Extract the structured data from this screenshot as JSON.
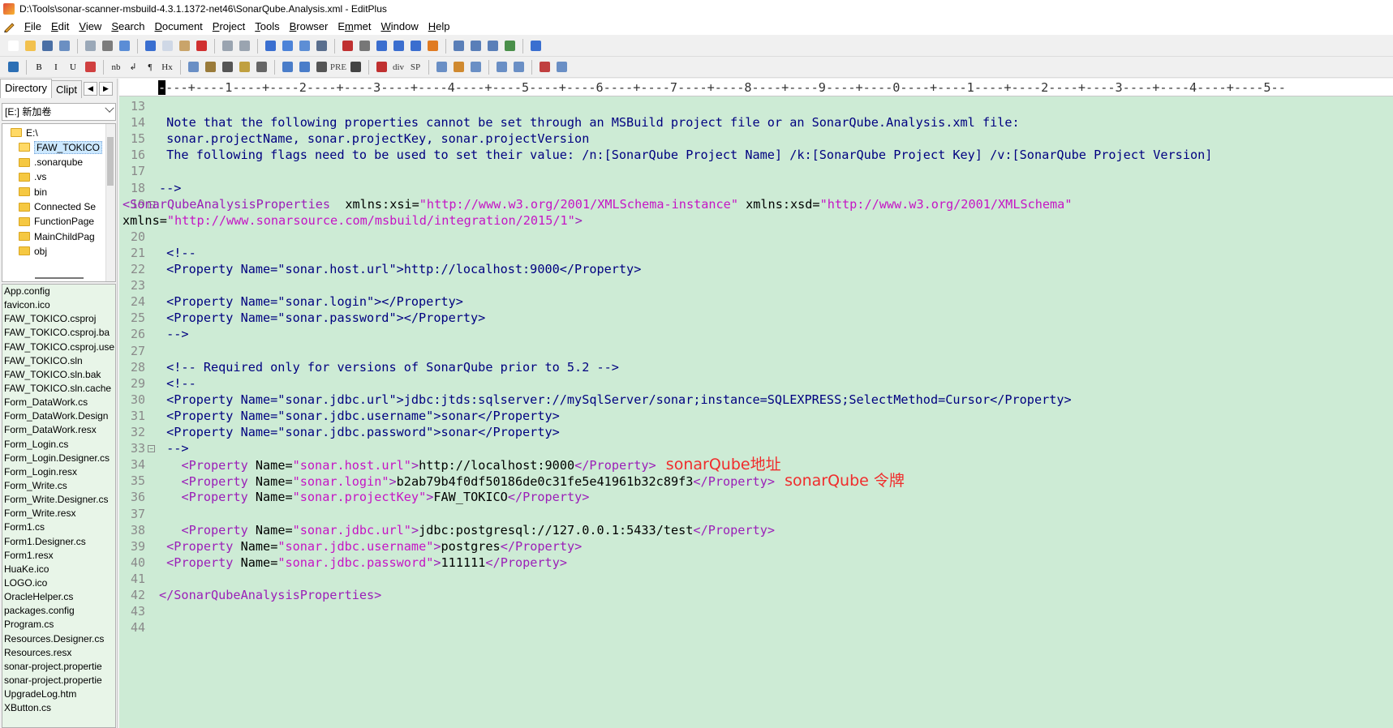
{
  "window": {
    "title": "D:\\Tools\\sonar-scanner-msbuild-4.3.1.1372-net46\\SonarQube.Analysis.xml - EditPlus"
  },
  "menu": [
    "File",
    "Edit",
    "View",
    "Search",
    "Document",
    "Project",
    "Tools",
    "Browser",
    "Emmet",
    "Window",
    "Help"
  ],
  "menu_hotkeys": [
    "F",
    "E",
    "V",
    "S",
    "D",
    "P",
    "T",
    "B",
    "m",
    "W",
    "H"
  ],
  "toolbar2_labels": {
    "bold": "B",
    "italic": "I",
    "underline": "U",
    "nbsp": "nb",
    "br": "↲",
    "para": "¶",
    "heading": "Hx",
    "pre": "PRE",
    "div": "div",
    "span": "SP"
  },
  "panel": {
    "tab_directory": "Directory",
    "tab_clipboard": "Clipt",
    "drive": "[E:] 新加卷",
    "tree": [
      "E:\\",
      "FAW_TOKICO",
      ".sonarqube",
      ".vs",
      "bin",
      "Connected Se",
      "FunctionPage",
      "MainChildPag",
      "obj"
    ],
    "files": [
      "App.config",
      "favicon.ico",
      "FAW_TOKICO.csproj",
      "FAW_TOKICO.csproj.ba",
      "FAW_TOKICO.csproj.use",
      "FAW_TOKICO.sln",
      "FAW_TOKICO.sln.bak",
      "FAW_TOKICO.sln.cache",
      "Form_DataWork.cs",
      "Form_DataWork.Design",
      "Form_DataWork.resx",
      "Form_Login.cs",
      "Form_Login.Designer.cs",
      "Form_Login.resx",
      "Form_Write.cs",
      "Form_Write.Designer.cs",
      "Form_Write.resx",
      "Form1.cs",
      "Form1.Designer.cs",
      "Form1.resx",
      "HuaKe.ico",
      "LOGO.ico",
      "OracleHelper.cs",
      "packages.config",
      "Program.cs",
      "Resources.Designer.cs",
      "Resources.resx",
      "sonar-project.propertie",
      "sonar-project.propertie",
      "UpgradeLog.htm",
      "XButton.cs"
    ]
  },
  "ruler": "---+----1----+----2----+----3----+----4----+----5----+----6----+----7----+----8----+----9----+----0----+----1----+----2----+----3----+----4----+----5--",
  "editor": {
    "lines": [
      {
        "n": "13",
        "t": ""
      },
      {
        "n": "14",
        "t": " Note that the following properties cannot be set through an MSBuild project file or an SonarQube.Analysis.xml file:"
      },
      {
        "n": "15",
        "t": " sonar.projectName, sonar.projectKey, sonar.projectVersion"
      },
      {
        "n": "16",
        "t": " The following flags need to be used to set their value: /n:[SonarQube Project Name] /k:[SonarQube Project Key] /v:[SonarQube Project Version]"
      },
      {
        "n": "17",
        "t": ""
      },
      {
        "n": "18",
        "t": "-->"
      },
      {
        "n": "19",
        "t": ""
      },
      {
        "n": "",
        "t": ""
      },
      {
        "n": "20",
        "t": ""
      },
      {
        "n": "21",
        "t": " <!--"
      },
      {
        "n": "22",
        "t": " <Property Name=\"sonar.host.url\">http://localhost:9000</Property>"
      },
      {
        "n": "23",
        "t": ""
      },
      {
        "n": "24",
        "t": " <Property Name=\"sonar.login\"></Property>"
      },
      {
        "n": "25",
        "t": " <Property Name=\"sonar.password\"></Property>"
      },
      {
        "n": "26",
        "t": " -->"
      },
      {
        "n": "27",
        "t": ""
      },
      {
        "n": "28",
        "t": " <!-- Required only for versions of SonarQube prior to 5.2 -->"
      },
      {
        "n": "29",
        "t": " <!--"
      },
      {
        "n": "30",
        "t": " <Property Name=\"sonar.jdbc.url\">jdbc:jtds:sqlserver://mySqlServer/sonar;instance=SQLEXPRESS;SelectMethod=Cursor</Property>"
      },
      {
        "n": "31",
        "t": " <Property Name=\"sonar.jdbc.username\">sonar</Property>"
      },
      {
        "n": "32",
        "t": " <Property Name=\"sonar.jdbc.password\">sonar</Property>"
      },
      {
        "n": "33",
        "t": " -->"
      },
      {
        "n": "34",
        "t": ""
      },
      {
        "n": "35",
        "t": ""
      },
      {
        "n": "36",
        "t": ""
      },
      {
        "n": "37",
        "t": ""
      },
      {
        "n": "38",
        "t": ""
      },
      {
        "n": "39",
        "t": ""
      },
      {
        "n": "40",
        "t": ""
      },
      {
        "n": "41",
        "t": ""
      },
      {
        "n": "42",
        "t": ""
      },
      {
        "n": "43",
        "t": ""
      },
      {
        "n": "44",
        "t": ""
      }
    ],
    "line19": {
      "tag": "SonarQubeAnalysisProperties",
      "a1": "xmlns:xsi",
      "v1": "\"http://www.w3.org/2001/XMLSchema-instance\"",
      "a2": "xmlns:xsd",
      "v2": "\"http://www.w3.org/2001/XMLSchema\"",
      "a3": "xmlns",
      "v3": "\"http://www.sonarsource.com/msbuild/integration/2015/1\""
    },
    "props": [
      {
        "indent": "   ",
        "name": "\"sonar.host.url\"",
        "value": "http://localhost:9000",
        "note": "sonarQube地址"
      },
      {
        "indent": "   ",
        "name": "\"sonar.login\"",
        "value": "b2ab79b4f0df50186de0c31fe5e41961b32c89f3",
        "note": "sonarQube 令牌"
      },
      {
        "indent": "   ",
        "name": "\"sonar.projectKey\"",
        "value": "FAW_TOKICO",
        "note": ""
      },
      {
        "indent": "   ",
        "name": "\"sonar.jdbc.url\"",
        "value": "jdbc:postgresql://127.0.0.1:5433/test",
        "note": ""
      },
      {
        "indent": " ",
        "name": "\"sonar.jdbc.username\"",
        "value": "postgres",
        "note": ""
      },
      {
        "indent": " ",
        "name": "\"sonar.jdbc.password\"",
        "value": "111111",
        "note": ""
      }
    ],
    "close_tag": "SonarQubeAnalysisProperties",
    "property_tag": "Property",
    "name_attr": "Name",
    "fold_minus": "⊟"
  }
}
